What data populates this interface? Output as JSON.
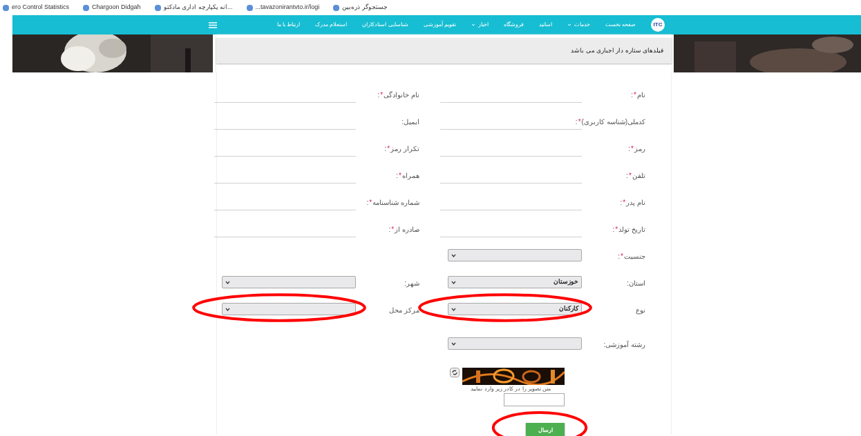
{
  "bookmarks": [
    {
      "label": "جستجوگر ذره‌بین"
    },
    {
      "label": "...tavazonirantvto.ir/logi"
    },
    {
      "label": "...انه یکپارچه اداری مادکتو"
    },
    {
      "label": "Chargoon Didgah"
    },
    {
      "label": "ero Control Statistics"
    }
  ],
  "nav": {
    "logo": "ITC",
    "items": [
      {
        "label": "صفحه نخست",
        "dropdown": false
      },
      {
        "label": "خدمات",
        "dropdown": true
      },
      {
        "label": "اساتید",
        "dropdown": false
      },
      {
        "label": "فروشگاه",
        "dropdown": false
      },
      {
        "label": "اخبار",
        "dropdown": true
      },
      {
        "label": "تقویم آموزشی",
        "dropdown": false
      },
      {
        "label": "شناسایی استادکاران",
        "dropdown": false
      },
      {
        "label": "استعلام مدرک",
        "dropdown": false
      },
      {
        "label": "ارتباط با ما",
        "dropdown": false
      }
    ]
  },
  "notice": "فیلدهای ستاره دار اجباری می باشد",
  "rows": [
    {
      "cells": [
        {
          "kind": "text",
          "label": "نام",
          "star": "*",
          "colon": ":"
        },
        {
          "kind": "text",
          "label": "نام خانوادگی",
          "star": "*",
          "colon": ":"
        }
      ]
    },
    {
      "cells": [
        {
          "kind": "text",
          "label": "کدملی(شناسه کاربری)",
          "star": "*",
          "colon": ":"
        },
        {
          "kind": "text",
          "label": "ایمیل",
          "colon": ":"
        }
      ]
    },
    {
      "cells": [
        {
          "kind": "text",
          "label": "رمز",
          "star": "*",
          "colon": ":"
        },
        {
          "kind": "text",
          "label": "تکرار رمز",
          "star": "*",
          "colon": ":"
        }
      ]
    },
    {
      "cells": [
        {
          "kind": "text",
          "label": "تلفن",
          "star": "*",
          "colon": ":"
        },
        {
          "kind": "text",
          "label": "همراه",
          "star": "*",
          "colon": ":"
        }
      ]
    },
    {
      "cells": [
        {
          "kind": "text",
          "label": "نام پدر",
          "star": "*",
          "colon": ":"
        },
        {
          "kind": "text",
          "label": "شماره شناسنامه",
          "star": "*",
          "colon": ":"
        }
      ]
    },
    {
      "cells": [
        {
          "kind": "text",
          "label": "تاریخ تولد",
          "star": "*",
          "colon": ":"
        },
        {
          "kind": "text",
          "label": "صادره از",
          "star": "*",
          "colon": ":"
        }
      ]
    },
    {
      "cells": [
        {
          "kind": "select",
          "label": "جنسیت",
          "star": "*",
          "colon": ":"
        }
      ]
    },
    {
      "cells": [
        {
          "kind": "select",
          "label": "استان",
          "colon": ":",
          "value": "خوزستان"
        },
        {
          "kind": "select",
          "label": "شهر",
          "colon": ":"
        }
      ]
    },
    {
      "cells": [
        {
          "kind": "select",
          "label": "نوع",
          "value": "کارکنان",
          "circled": true
        },
        {
          "kind": "select",
          "label": "مرکز محل",
          "circled": true
        }
      ]
    },
    {
      "cells": [
        {
          "kind": "select",
          "label": "رشته آموزشی",
          "colon": ":"
        }
      ]
    }
  ],
  "captcha": {
    "hint": "متن تصویر را در کادر زیر وارد نمایید"
  },
  "submit": {
    "label": "ارسال",
    "circled": true
  }
}
